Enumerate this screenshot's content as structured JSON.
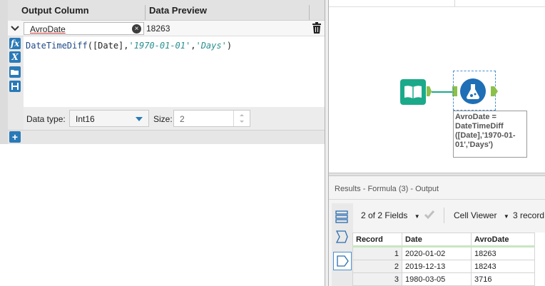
{
  "formula_panel": {
    "col_header": "Output Column",
    "data_header": "Data Preview",
    "output_column_value": "AvroDate",
    "data_preview_value": "18263",
    "expression": {
      "fn": "DateTimeDiff",
      "open": "(",
      "field": "[Date]",
      "comma1": ",",
      "arg1": "'1970-01-01'",
      "comma2": ",",
      "arg2": "'Days'",
      "close": ")"
    },
    "data_type_label": "Data type:",
    "data_type_value": "Int16",
    "size_label": "Size:",
    "size_value": "2",
    "icons": [
      "fx-icon",
      "variable-icon",
      "open-folder-icon",
      "save-icon"
    ]
  },
  "workflow": {
    "annotation": "AvroDate = DateTimeDiff ([Date],'1970-01-01','Days')"
  },
  "results": {
    "title": "Results - Formula (3) - Output",
    "fields_selector": "2 of 2 Fields",
    "cell_viewer": "Cell Viewer",
    "records_label": "3 record",
    "columns": [
      "Record",
      "Date",
      "AvroDate"
    ],
    "rows": [
      {
        "record": "1",
        "date": "2020-01-02",
        "avro": "18263"
      },
      {
        "record": "2",
        "date": "2019-12-13",
        "avro": "18243"
      },
      {
        "record": "3",
        "date": "1980-03-05",
        "avro": "3716"
      }
    ]
  },
  "colors": {
    "accent_blue": "#2a7ab8",
    "tool_green": "#1aaa8a",
    "tool_blue": "#1e6fb5",
    "connector_green": "#8cc04b"
  }
}
